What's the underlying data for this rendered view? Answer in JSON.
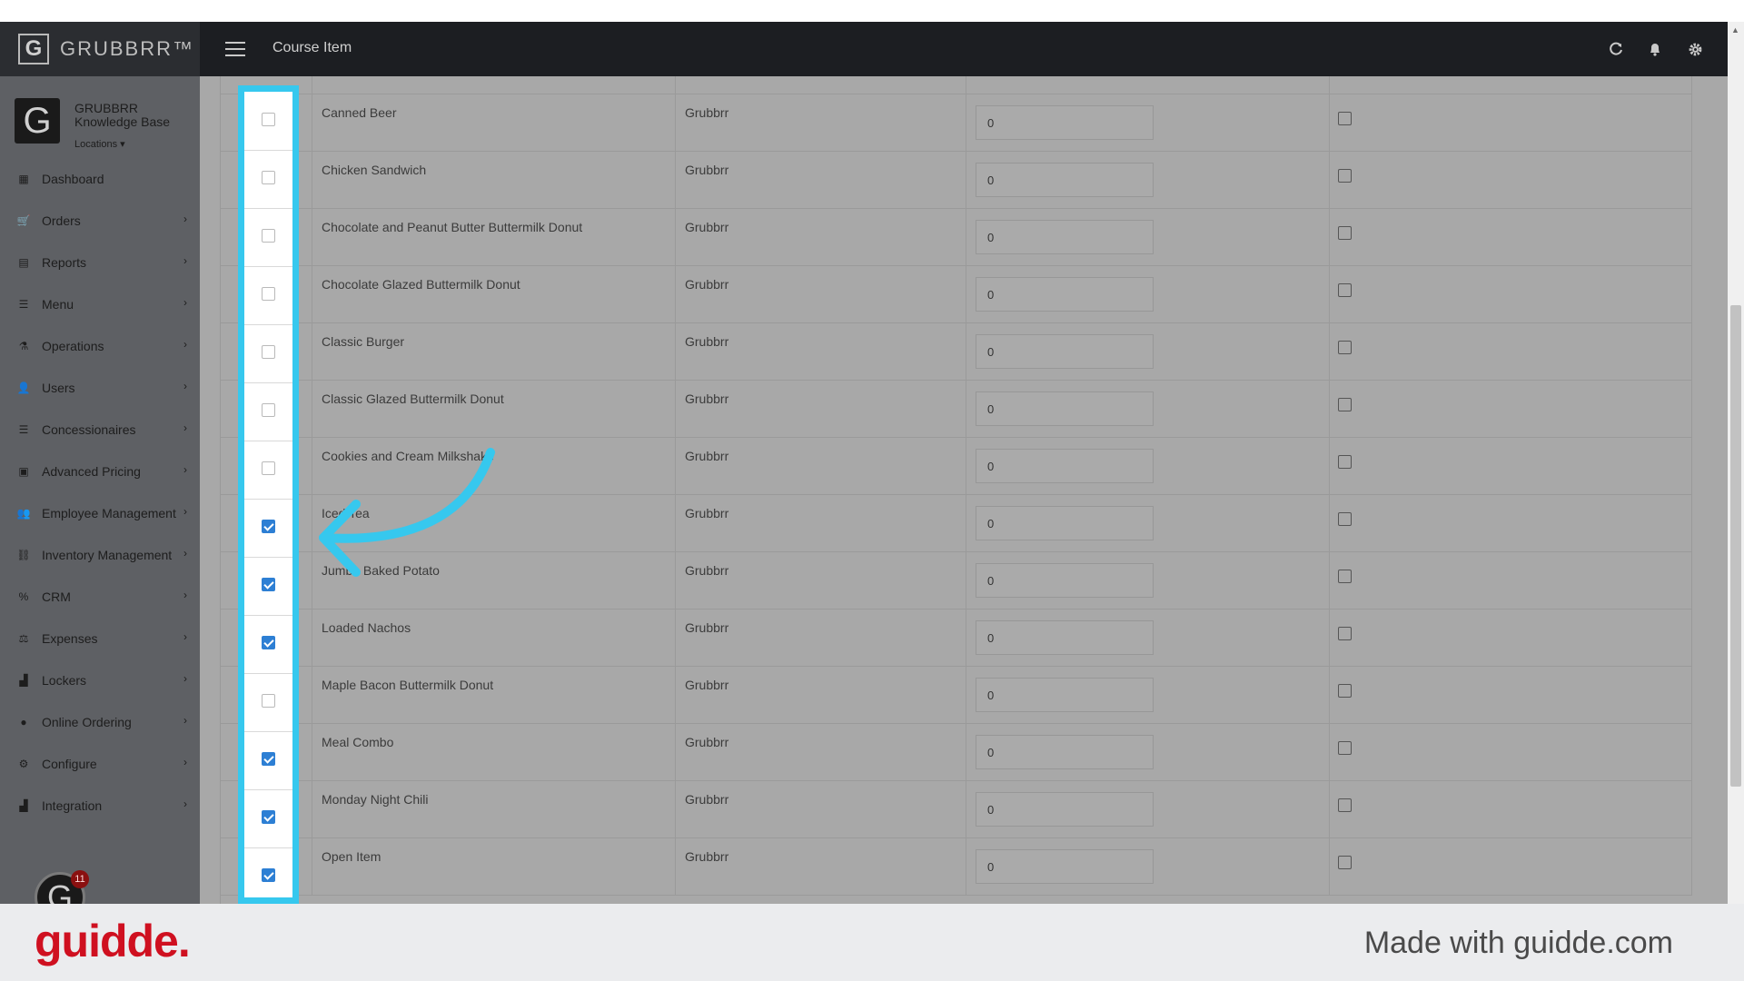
{
  "header": {
    "brand": "GRUBBRR™",
    "brand_logo": "G",
    "page_title": "Course Item",
    "icons": [
      "refresh-icon",
      "bell-icon",
      "gear-icon"
    ]
  },
  "profile": {
    "logo": "G",
    "name": "GRUBBRR Knowledge Base",
    "locations_label": "Locations ▾"
  },
  "sidebar": {
    "items": [
      {
        "label": "Dashboard",
        "icon": "dashboard-icon",
        "glyph": "▦",
        "chevron": false
      },
      {
        "label": "Orders",
        "icon": "cart-icon",
        "glyph": "🛒",
        "chevron": true
      },
      {
        "label": "Reports",
        "icon": "report-icon",
        "glyph": "▤",
        "chevron": true
      },
      {
        "label": "Menu",
        "icon": "menu-list-icon",
        "glyph": "☰",
        "chevron": true
      },
      {
        "label": "Operations",
        "icon": "flask-icon",
        "glyph": "⚗",
        "chevron": true
      },
      {
        "label": "Users",
        "icon": "user-add-icon",
        "glyph": "👤",
        "chevron": true
      },
      {
        "label": "Concessionaires",
        "icon": "list-icon",
        "glyph": "☰",
        "chevron": true
      },
      {
        "label": "Advanced Pricing",
        "icon": "money-icon",
        "glyph": "▣",
        "chevron": true
      },
      {
        "label": "Employee Management",
        "icon": "group-icon",
        "glyph": "👥",
        "chevron": true
      },
      {
        "label": "Inventory Management",
        "icon": "sitemap-icon",
        "glyph": "⛓",
        "chevron": true
      },
      {
        "label": "CRM",
        "icon": "link-icon",
        "glyph": "%",
        "chevron": true
      },
      {
        "label": "Expenses",
        "icon": "scale-icon",
        "glyph": "⚖",
        "chevron": true
      },
      {
        "label": "Lockers",
        "icon": "locker-icon",
        "glyph": "▟",
        "chevron": true
      },
      {
        "label": "Online Ordering",
        "icon": "globe-icon",
        "glyph": "●",
        "chevron": true
      },
      {
        "label": "Configure",
        "icon": "cog-icon",
        "glyph": "⚙",
        "chevron": true
      },
      {
        "label": "Integration",
        "icon": "integration-icon",
        "glyph": "▟",
        "chevron": true
      }
    ],
    "avatar_letter": "G",
    "notification_count": "11"
  },
  "table": {
    "rows": [
      {
        "name": "Canned Beer",
        "vendor": "Grubbrr",
        "value": "0",
        "selected": false
      },
      {
        "name": "Chicken Sandwich",
        "vendor": "Grubbrr",
        "value": "0",
        "selected": false
      },
      {
        "name": "Chocolate and Peanut Butter Buttermilk Donut",
        "vendor": "Grubbrr",
        "value": "0",
        "selected": false
      },
      {
        "name": "Chocolate Glazed Buttermilk Donut",
        "vendor": "Grubbrr",
        "value": "0",
        "selected": false
      },
      {
        "name": "Classic Burger",
        "vendor": "Grubbrr",
        "value": "0",
        "selected": false
      },
      {
        "name": "Classic Glazed Buttermilk Donut",
        "vendor": "Grubbrr",
        "value": "0",
        "selected": false
      },
      {
        "name": "Cookies and Cream Milkshake",
        "vendor": "Grubbrr",
        "value": "0",
        "selected": false
      },
      {
        "name": "Iced Tea",
        "vendor": "Grubbrr",
        "value": "0",
        "selected": true
      },
      {
        "name": "Jumbo Baked Potato",
        "vendor": "Grubbrr",
        "value": "0",
        "selected": true
      },
      {
        "name": "Loaded Nachos",
        "vendor": "Grubbrr",
        "value": "0",
        "selected": true
      },
      {
        "name": "Maple Bacon Buttermilk Donut",
        "vendor": "Grubbrr",
        "value": "0",
        "selected": false
      },
      {
        "name": "Meal Combo",
        "vendor": "Grubbrr",
        "value": "0",
        "selected": true
      },
      {
        "name": "Monday Night Chili",
        "vendor": "Grubbrr",
        "value": "0",
        "selected": true
      },
      {
        "name": "Open Item",
        "vendor": "Grubbrr",
        "value": "0",
        "selected": true
      }
    ]
  },
  "annotation": {
    "arrow_color": "#36c8ee",
    "highlight_color": "#36c8ee"
  },
  "footer": {
    "logo": "guidde.",
    "made_with": "Made with guidde.com"
  },
  "colors": {
    "checkbox_checked": "#2d7fd4",
    "footer_logo": "#cf1020"
  }
}
